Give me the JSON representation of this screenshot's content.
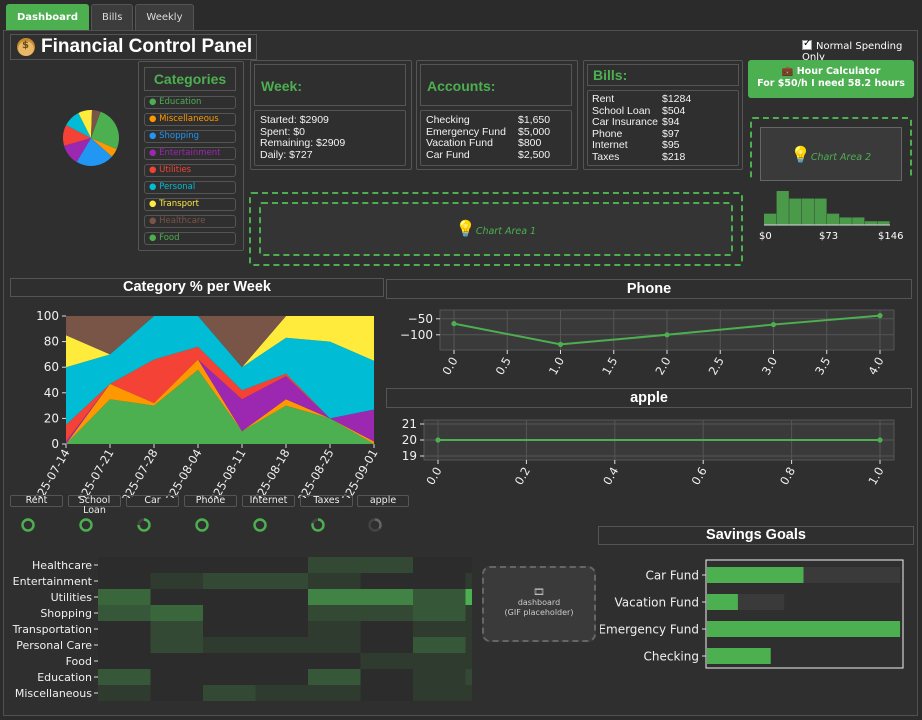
{
  "tabs": [
    {
      "label": "Dashboard",
      "active": true
    },
    {
      "label": "Bills",
      "active": false
    },
    {
      "label": "Weekly",
      "active": false
    }
  ],
  "header": {
    "title": "Financial Control Panel",
    "icon": "money-bag-icon",
    "toggle_label": "Normal Spending Only",
    "toggle_checked": true
  },
  "categories": {
    "title": "Categories",
    "items": [
      {
        "label": "Education",
        "color": "#4caf50"
      },
      {
        "label": "Miscellaneous",
        "color": "#ff9800"
      },
      {
        "label": "Shopping",
        "color": "#2196f3"
      },
      {
        "label": "Entertainment",
        "color": "#9c27b0"
      },
      {
        "label": "Utilities",
        "color": "#f44336"
      },
      {
        "label": "Personal",
        "color": "#00bcd4"
      },
      {
        "label": "Transport",
        "color": "#ffeb3b"
      },
      {
        "label": "Healthcare",
        "color": "#795548"
      },
      {
        "label": "Food",
        "color": "#4caf50"
      }
    ]
  },
  "week": {
    "title": "Week:",
    "lines": [
      "Started: $2909",
      "Spent: $0",
      "Remaining: $2909",
      "Daily: $727"
    ]
  },
  "accounts": {
    "title": "Accounts:",
    "rows": [
      [
        "Checking",
        "$1,650"
      ],
      [
        "Emergency Fund",
        "$5,000"
      ],
      [
        "Vacation Fund",
        "$800"
      ],
      [
        "Car Fund",
        "$2,500"
      ]
    ]
  },
  "bills": {
    "title": "Bills:",
    "rows": [
      [
        "Rent",
        "$1284"
      ],
      [
        "School Loan",
        "$504"
      ],
      [
        "Car Insurance",
        "$94"
      ],
      [
        "Phone",
        "$97"
      ],
      [
        "Internet",
        "$95"
      ],
      [
        "Taxes",
        "$218"
      ]
    ]
  },
  "hour_calc": {
    "title": "Hour Calculator",
    "subtitle": "For $50/h I need 58.2 hours",
    "icon": "briefcase-icon"
  },
  "chart_area_1": {
    "label": "Chart Area 1",
    "icon": "lightbulb-icon"
  },
  "chart_area_2": {
    "label": "Chart Area 2",
    "icon": "lightbulb-icon"
  },
  "histogram": {
    "ticks": [
      "$0",
      "$73",
      "$146"
    ],
    "values": [
      3,
      9,
      7,
      7,
      7,
      3,
      2,
      2,
      1,
      1
    ]
  },
  "cat_pct": {
    "title": "Category % per Week"
  },
  "phone_chart": {
    "title": "Phone"
  },
  "apple_chart": {
    "title": "apple"
  },
  "bill_tabs": [
    "Rent",
    "School Loan",
    "Car",
    "Phone",
    "Internet",
    "Taxes",
    "apple"
  ],
  "progress": [
    1.0,
    1.0,
    0.75,
    1.0,
    1.0,
    0.8,
    0.35
  ],
  "gif": {
    "name": "dashboard",
    "caption": "(GIF placeholder)",
    "icon": "film-icon"
  },
  "savings": {
    "title": "Savings Goals"
  },
  "heatmap_rows": [
    "Healthcare",
    "Entertainment",
    "Utilities",
    "Shopping",
    "Transportation",
    "Personal Care",
    "Food",
    "Education",
    "Miscellaneous"
  ],
  "chart_data": [
    {
      "type": "pie",
      "labels": [
        "Education",
        "Miscellaneous",
        "Shopping",
        "Entertainment",
        "Utilities",
        "Personal",
        "Transport",
        "Healthcare"
      ],
      "values": [
        26,
        5,
        22,
        12,
        12,
        10,
        8,
        5
      ],
      "colors": [
        "#4caf50",
        "#ff9800",
        "#2196f3",
        "#9c27b0",
        "#f44336",
        "#00bcd4",
        "#ffeb3b",
        "#795548"
      ]
    },
    {
      "type": "area",
      "title": "Category % per Week",
      "categories": [
        "2025-07-14",
        "2025-07-21",
        "2025-07-28",
        "2025-08-04",
        "2025-08-11",
        "2025-08-18",
        "2025-08-25",
        "2025-09-01"
      ],
      "ylim": [
        0,
        100
      ],
      "yticks": [
        0,
        20,
        40,
        60,
        80,
        100
      ],
      "series": [
        {
          "color": "#4caf50",
          "values": [
            0,
            35,
            30,
            58,
            10,
            30,
            20,
            0
          ]
        },
        {
          "color": "#ff9800",
          "values": [
            0,
            12,
            2,
            8,
            0,
            5,
            0,
            2
          ]
        },
        {
          "color": "#9c27b0",
          "values": [
            2,
            0,
            0,
            0,
            25,
            18,
            0,
            25
          ]
        },
        {
          "color": "#f44336",
          "values": [
            13,
            0,
            34,
            10,
            7,
            2,
            0,
            0
          ]
        },
        {
          "color": "#00bcd4",
          "values": [
            45,
            23,
            34,
            24,
            18,
            28,
            60,
            38
          ]
        },
        {
          "color": "#ffeb3b",
          "values": [
            25,
            0,
            0,
            0,
            0,
            17,
            20,
            35
          ]
        },
        {
          "color": "#795548",
          "values": [
            15,
            30,
            0,
            0,
            40,
            0,
            0,
            0
          ]
        }
      ]
    },
    {
      "type": "line",
      "title": "Phone",
      "x": [
        0,
        1,
        2,
        3,
        4
      ],
      "y": [
        -65,
        -130,
        -100,
        -68,
        -40
      ],
      "xticks": [
        "0.0",
        "0.5",
        "1.0",
        "1.5",
        "2.0",
        "2.5",
        "3.0",
        "3.5",
        "4.0"
      ],
      "yticks": [
        -50,
        -100
      ],
      "ylim": [
        -135,
        -35
      ]
    },
    {
      "type": "line",
      "title": "apple",
      "x": [
        0,
        1
      ],
      "y": [
        20,
        20
      ],
      "xticks": [
        "0.0",
        "0.2",
        "0.4",
        "0.6",
        "0.8",
        "1.0"
      ],
      "yticks": [
        19,
        20,
        21
      ],
      "ylim": [
        19,
        21
      ]
    },
    {
      "type": "bar",
      "title": "Savings Goals",
      "categories": [
        "Car Fund",
        "Vacation Fund",
        "Emergency Fund",
        "Checking"
      ],
      "values": [
        2500,
        800,
        5000,
        1650
      ],
      "targets": [
        5000,
        2000,
        5000,
        1650
      ]
    },
    {
      "type": "heatmap",
      "rows": [
        "Healthcare",
        "Entertainment",
        "Utilities",
        "Shopping",
        "Transportation",
        "Personal Care",
        "Food",
        "Education",
        "Miscellaneous"
      ],
      "values": [
        [
          0,
          0,
          0,
          0,
          2,
          2,
          0,
          0
        ],
        [
          0,
          1,
          2,
          2,
          1,
          0,
          0,
          1
        ],
        [
          4,
          0,
          0,
          0,
          6,
          6,
          3,
          9
        ],
        [
          3,
          4,
          0,
          0,
          2,
          2,
          3,
          1
        ],
        [
          0,
          2,
          0,
          0,
          1,
          0,
          1,
          1
        ],
        [
          0,
          2,
          1,
          1,
          1,
          0,
          3,
          1
        ],
        [
          0,
          0,
          0,
          0,
          0,
          1,
          1,
          1
        ],
        [
          3,
          0,
          0,
          0,
          3,
          0,
          1,
          2
        ],
        [
          1,
          0,
          2,
          1,
          1,
          0,
          1,
          1
        ]
      ]
    }
  ]
}
